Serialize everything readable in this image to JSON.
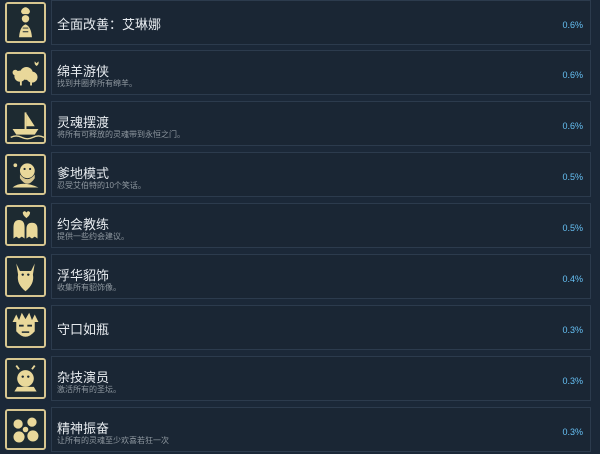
{
  "achievements": [
    {
      "title": "全面改善：艾琳娜",
      "description": "",
      "percent": "0.6%",
      "icon": "chef-girl-icon"
    },
    {
      "title": "绵羊游侠",
      "description": "找到并圈养所有绵羊。",
      "percent": "0.6%",
      "icon": "sheep-icon"
    },
    {
      "title": "灵魂摆渡",
      "description": "将所有可释放的灵魂带到永恒之门。",
      "percent": "0.6%",
      "icon": "ferry-boat-icon"
    },
    {
      "title": "爹地模式",
      "description": "忍受艾伯特的10个笑话。",
      "percent": "0.5%",
      "icon": "old-man-icon"
    },
    {
      "title": "约会教练",
      "description": "提供一些约会建议。",
      "percent": "0.5%",
      "icon": "ghost-lovers-icon"
    },
    {
      "title": "浮华貂饰",
      "description": "收集所有貂饰像。",
      "percent": "0.4%",
      "icon": "cat-figure-icon"
    },
    {
      "title": "守口如瓶",
      "description": "",
      "percent": "0.3%",
      "icon": "spiky-hair-face-icon"
    },
    {
      "title": "杂技演员",
      "description": "激活所有的圣坛。",
      "percent": "0.3%",
      "icon": "acrobat-icon"
    },
    {
      "title": "精神振奋",
      "description": "让所有的灵魂至少欢喜若狂一次",
      "percent": "0.3%",
      "icon": "spirits-icon"
    }
  ],
  "colors": {
    "background": "#1b2838",
    "panel": "#1a2634",
    "icon_border": "#d7c690",
    "percent": "#66c0f4"
  }
}
